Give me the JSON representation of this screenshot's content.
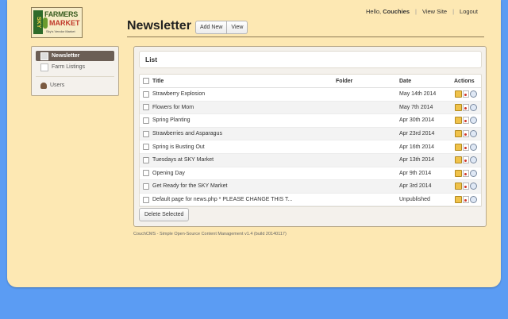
{
  "header": {
    "hello_prefix": "Hello,",
    "user": "Couchies",
    "view_site": "View Site",
    "logout": "Logout"
  },
  "logo": {
    "line1": "FARMERS",
    "line2": "MARKET",
    "sky": "SKY",
    "tagline": "Sky's Vendor Market"
  },
  "page": {
    "title": "Newsletter",
    "add_new": "Add New",
    "view": "View"
  },
  "sidebar": {
    "items": [
      {
        "label": "Newsletter",
        "active": true
      },
      {
        "label": "Farm Listings",
        "active": false
      },
      {
        "label": "Users",
        "active": false
      }
    ]
  },
  "list": {
    "heading": "List",
    "columns": {
      "title": "Title",
      "folder": "Folder",
      "date": "Date",
      "actions": "Actions"
    },
    "rows": [
      {
        "title": "Strawberry Explosion",
        "folder": "",
        "date": "May 14th 2014"
      },
      {
        "title": "Flowers for Mom",
        "folder": "",
        "date": "May 7th 2014"
      },
      {
        "title": "Spring Planting",
        "folder": "",
        "date": "Apr 30th 2014"
      },
      {
        "title": "Strawberries and Asparagus",
        "folder": "",
        "date": "Apr 23rd 2014"
      },
      {
        "title": "Spring is Busting Out",
        "folder": "",
        "date": "Apr 16th 2014"
      },
      {
        "title": "Tuesdays at SKY Market",
        "folder": "",
        "date": "Apr 13th 2014"
      },
      {
        "title": "Opening Day",
        "folder": "",
        "date": "Apr 9th 2014"
      },
      {
        "title": "Get Ready for the SKY Market",
        "folder": "",
        "date": "Apr 3rd 2014"
      },
      {
        "title": "Default page for news.php * PLEASE CHANGE THIS T...",
        "folder": "",
        "date": "Unpublished"
      }
    ],
    "delete_selected": "Delete Selected"
  },
  "footer": {
    "text": "CouchCMS - Simple Open-Source Content Management v1.4 (build 20140117)"
  },
  "colors": {
    "background": "#5b9cf3",
    "page": "#fde8b3",
    "active_nav": "#6b5e55"
  }
}
